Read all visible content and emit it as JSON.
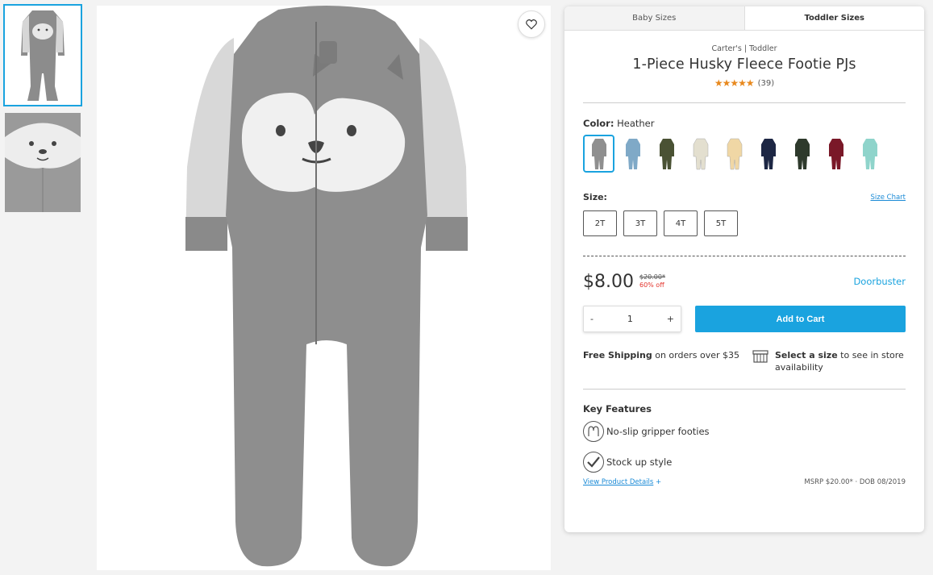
{
  "size_tabs": [
    "Baby Sizes",
    "Toddler Sizes"
  ],
  "product": {
    "brand": "Carter's | Toddler",
    "title": "1-Piece Husky Fleece Footie PJs",
    "stars": "★★★★★",
    "review_count": "(39)"
  },
  "color": {
    "label": "Color:",
    "selected": "Heather",
    "swatches": [
      {
        "name": "Heather",
        "color": "#8f8f8f"
      },
      {
        "name": "Blue",
        "color": "#7fa9c7"
      },
      {
        "name": "Camo",
        "color": "#4a5234"
      },
      {
        "name": "Cream",
        "color": "#e3dfcf"
      },
      {
        "name": "Multi",
        "color": "#f0d7a5"
      },
      {
        "name": "Navy",
        "color": "#1d2744"
      },
      {
        "name": "Dark Green",
        "color": "#2e3a2c"
      },
      {
        "name": "Burgundy",
        "color": "#7a1828"
      },
      {
        "name": "Mint",
        "color": "#8fd4cb"
      }
    ]
  },
  "size": {
    "label": "Size:",
    "chart_link": "Size Chart",
    "options": [
      "2T",
      "3T",
      "4T",
      "5T"
    ]
  },
  "price": {
    "current": "$8.00",
    "was": "$20.00*",
    "discount": "60% off",
    "badge": "Doorbuster"
  },
  "cart": {
    "minus": "-",
    "quantity": "1",
    "plus": "+",
    "add_label": "Add to Cart"
  },
  "shipping": {
    "free_label": "Free Shipping",
    "free_text": " on orders over $35",
    "store_bold": "Select a size",
    "store_text": " to see in store availability"
  },
  "features": {
    "title": "Key Features",
    "items": [
      "No-slip gripper footies",
      "Stock up style"
    ]
  },
  "footer": {
    "details_link": "View Product Details",
    "details_plus": "+",
    "msrp": "MSRP $20.00* · DOB 08/2019"
  },
  "icons": {
    "favorite": "heart-icon",
    "store": "store-icon",
    "gripper": "footprint-icon",
    "stock": "checkmark-icon"
  }
}
